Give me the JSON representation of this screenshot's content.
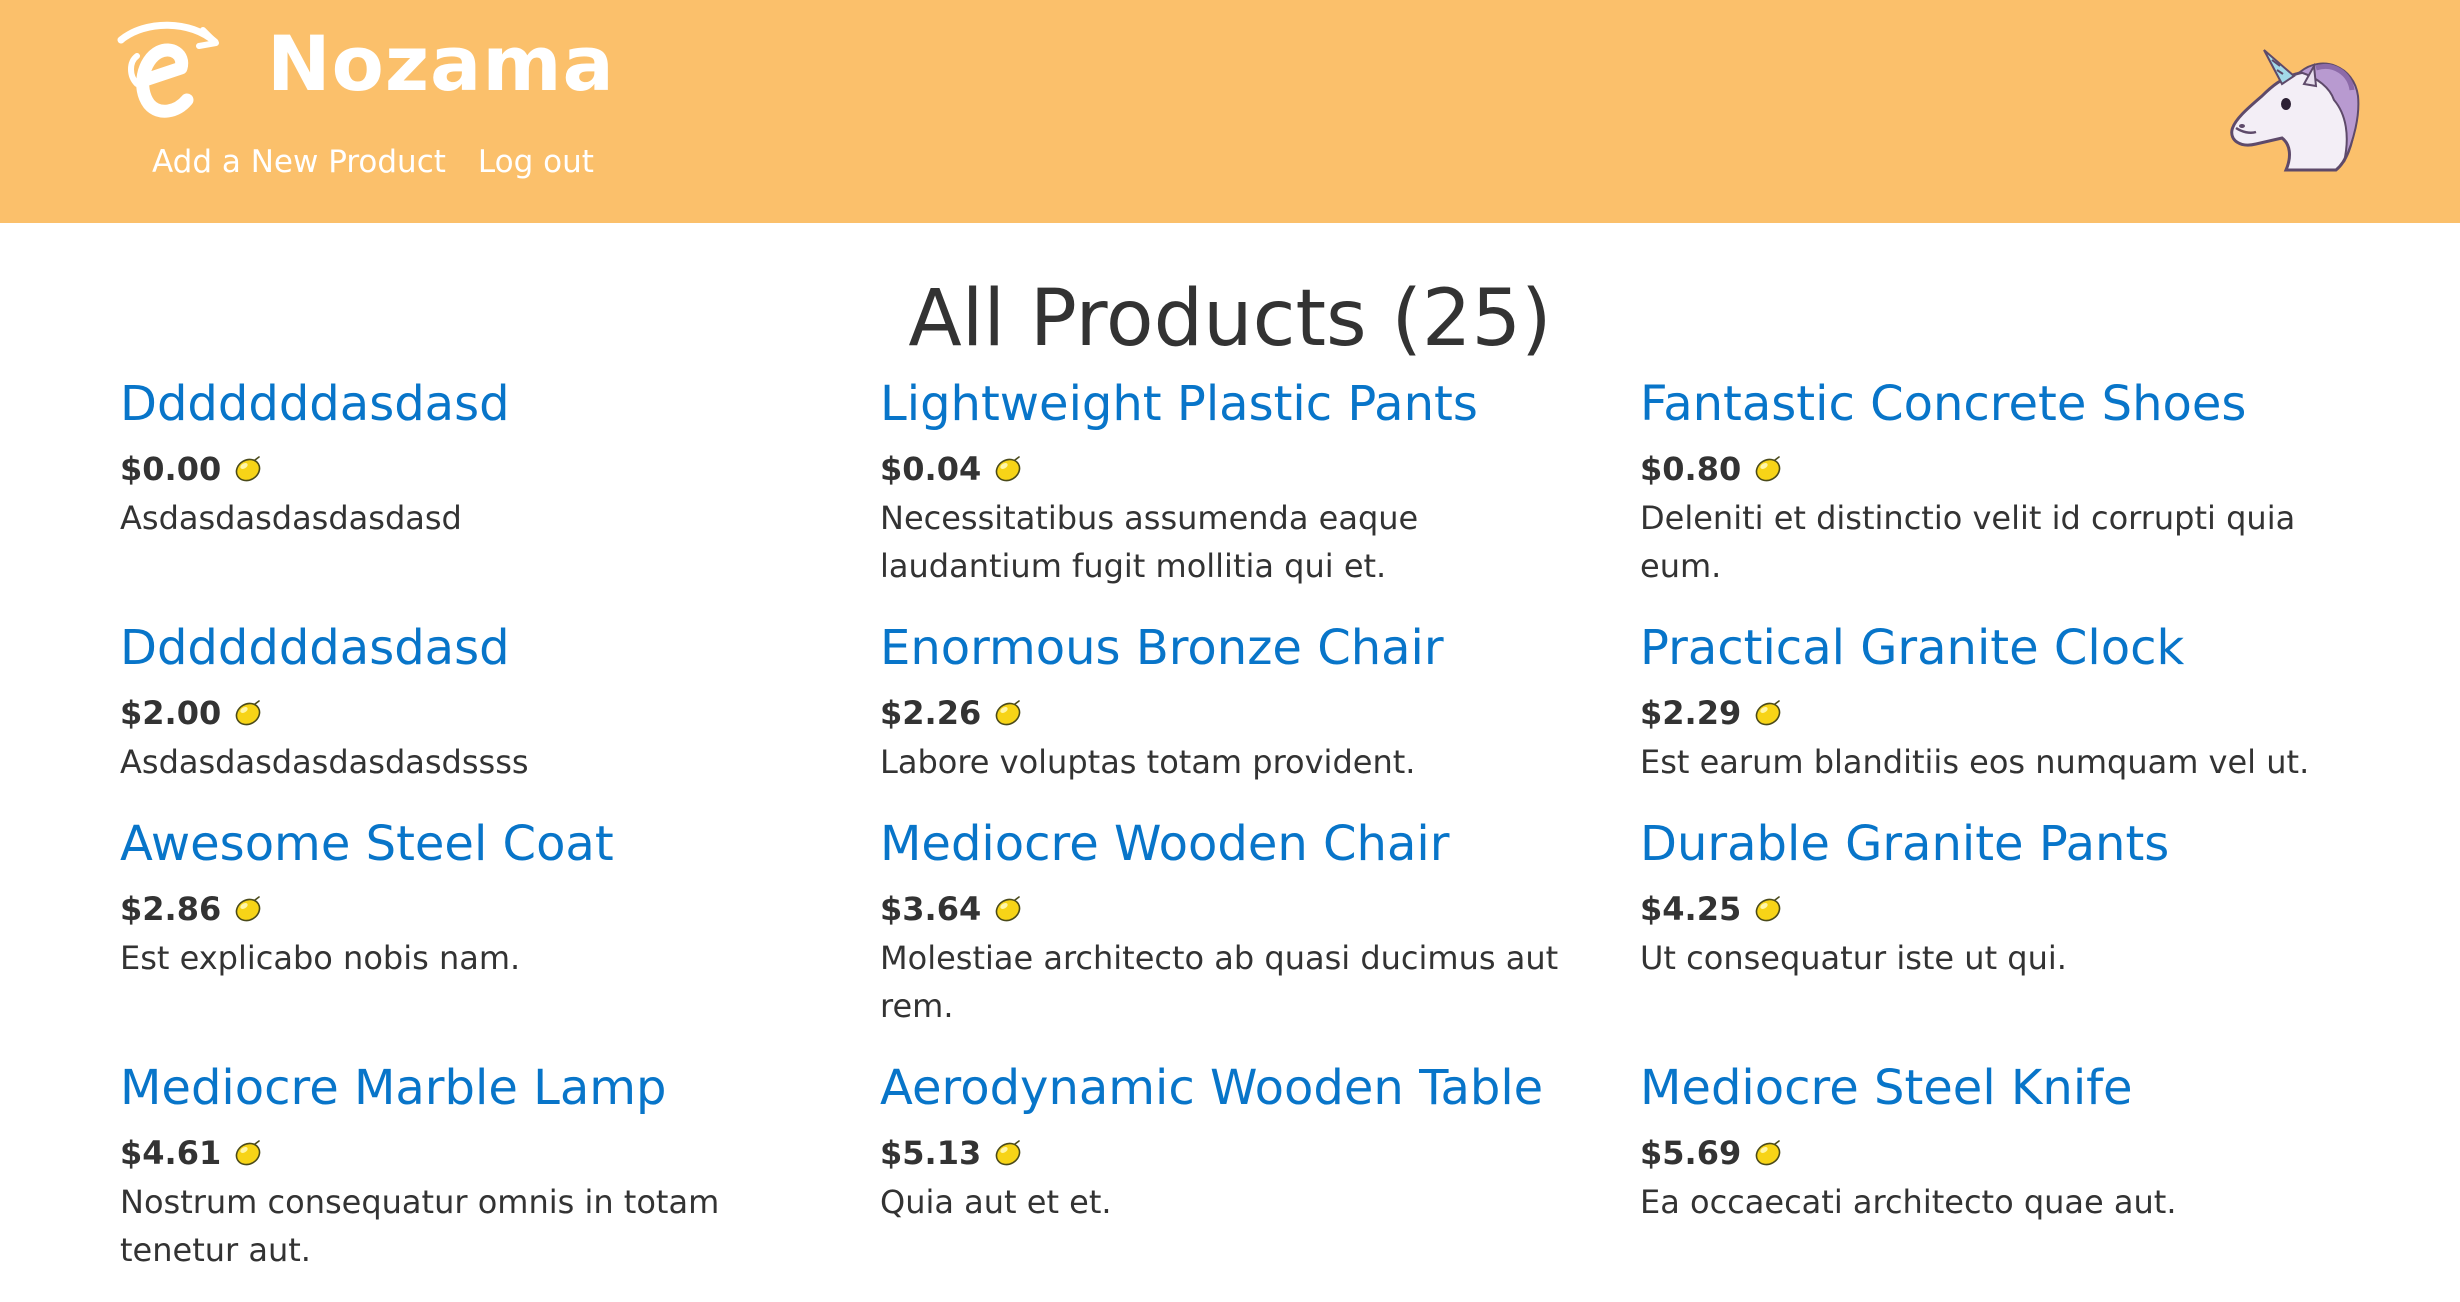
{
  "header": {
    "brand": "Nozama",
    "logo_icon": "nozama-logo-icon",
    "avatar_icon": "unicorn-icon",
    "background_color": "#fbc06b",
    "nav": [
      {
        "label": "Add a New Product"
      },
      {
        "label": "Log out"
      }
    ]
  },
  "main": {
    "title": "All Products (25)",
    "link_color": "#0875c9",
    "price_icon": "lemon-icon",
    "products": [
      {
        "name": "Dddddddasdasd",
        "price": "$0.00",
        "description": "Asdasdasdasdasdasd"
      },
      {
        "name": "Lightweight Plastic Pants",
        "price": "$0.04",
        "description": "Necessitatibus assumenda eaque laudantium fugit mollitia qui et."
      },
      {
        "name": "Fantastic Concrete Shoes",
        "price": "$0.80",
        "description": "Deleniti et distinctio velit id corrupti quia eum."
      },
      {
        "name": "Dddddddasdasd",
        "price": "$2.00",
        "description": "Asdasdasdasdasdasdssss"
      },
      {
        "name": "Enormous Bronze Chair",
        "price": "$2.26",
        "description": "Labore voluptas totam provident."
      },
      {
        "name": "Practical Granite Clock",
        "price": "$2.29",
        "description": "Est earum blanditiis eos numquam vel ut."
      },
      {
        "name": "Awesome Steel Coat",
        "price": "$2.86",
        "description": "Est explicabo nobis nam."
      },
      {
        "name": "Mediocre Wooden Chair",
        "price": "$3.64",
        "description": "Molestiae architecto ab quasi ducimus aut rem."
      },
      {
        "name": "Durable Granite Pants",
        "price": "$4.25",
        "description": "Ut consequatur iste ut qui."
      },
      {
        "name": "Mediocre Marble Lamp",
        "price": "$4.61",
        "description": "Nostrum consequatur omnis in totam tenetur aut."
      },
      {
        "name": "Aerodynamic Wooden Table",
        "price": "$5.13",
        "description": "Quia aut et et."
      },
      {
        "name": "Mediocre Steel Knife",
        "price": "$5.69",
        "description": "Ea occaecati architecto quae aut."
      }
    ]
  }
}
